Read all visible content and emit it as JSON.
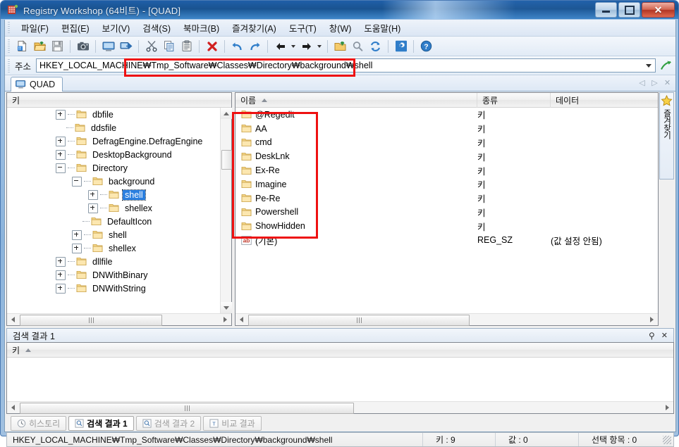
{
  "window": {
    "title": "Registry Workshop (64비트) - [QUAD]",
    "app_icon": "registry-app-icon",
    "minimize_label": "최소화",
    "maximize_label": "최대화",
    "close_label": "닫기"
  },
  "menu": {
    "items": [
      {
        "label": "파일(F)"
      },
      {
        "label": "편집(E)"
      },
      {
        "label": "보기(V)"
      },
      {
        "label": "검색(S)"
      },
      {
        "label": "북마크(B)"
      },
      {
        "label": "즐겨찾기(A)"
      },
      {
        "label": "도구(T)"
      },
      {
        "label": "창(W)"
      },
      {
        "label": "도움말(H)"
      }
    ]
  },
  "toolbar": {
    "buttons": [
      {
        "icon": "new-document-icon",
        "sep_after": false
      },
      {
        "icon": "open-folder-icon",
        "sep_after": false
      },
      {
        "icon": "save-icon",
        "sep_after": true
      },
      {
        "icon": "snapshot-camera-icon",
        "sep_after": true
      },
      {
        "icon": "monitor-icon",
        "sep_after": false
      },
      {
        "icon": "export-monitor-icon",
        "sep_after": true
      },
      {
        "icon": "cut-scissors-icon",
        "sep_after": false
      },
      {
        "icon": "copy-icon",
        "sep_after": false
      },
      {
        "icon": "paste-icon",
        "sep_after": true
      },
      {
        "icon": "delete-x-icon",
        "sep_after": true
      },
      {
        "icon": "undo-icon",
        "sep_after": false
      },
      {
        "icon": "redo-icon",
        "sep_after": true
      },
      {
        "icon": "back-arrow-icon",
        "sep_after": false,
        "dropdown": true
      },
      {
        "icon": "forward-arrow-icon",
        "sep_after": true,
        "dropdown": true
      },
      {
        "icon": "parent-folder-up-icon",
        "sep_after": false
      },
      {
        "icon": "find-magnifier-icon",
        "sep_after": false
      },
      {
        "icon": "refresh-icon",
        "sep_after": true
      },
      {
        "icon": "settings-gear-icon",
        "sep_after": true
      },
      {
        "icon": "help-question-icon",
        "sep_after": false
      }
    ]
  },
  "address": {
    "label": "주소",
    "value": "HKEY_LOCAL_MACHINE₩Tmp_Software₩Classes₩Directory₩background₩shell",
    "dropdown_icon": "chevron-down-icon",
    "go_icon": "go-arrow-icon"
  },
  "doc_tabs": {
    "tabs": [
      {
        "label": "QUAD",
        "icon": "monitor-icon",
        "active": true
      }
    ],
    "nav_prev_icon": "triangle-left-icon",
    "nav_next_icon": "triangle-right-icon",
    "close_icon": "close-x-icon"
  },
  "favorites_panel": {
    "icon": "star-icon",
    "label": "즐겨찾기"
  },
  "tree_pane": {
    "column_header": "키",
    "nodes": [
      {
        "label": "dbfile",
        "indent": 3,
        "expander": "plus",
        "selected": false
      },
      {
        "label": "ddsfile",
        "indent": 3,
        "expander": "none",
        "selected": false
      },
      {
        "label": "DefragEngine.DefragEngine",
        "indent": 3,
        "expander": "plus",
        "selected": false
      },
      {
        "label": "DesktopBackground",
        "indent": 3,
        "expander": "plus",
        "selected": false
      },
      {
        "label": "Directory",
        "indent": 3,
        "expander": "minus",
        "selected": false
      },
      {
        "label": "background",
        "indent": 4,
        "expander": "minus",
        "selected": false
      },
      {
        "label": "shell",
        "indent": 5,
        "expander": "plus",
        "selected": true
      },
      {
        "label": "shellex",
        "indent": 5,
        "expander": "plus",
        "selected": false
      },
      {
        "label": "DefaultIcon",
        "indent": 4,
        "expander": "none",
        "selected": false
      },
      {
        "label": "shell",
        "indent": 4,
        "expander": "plus",
        "selected": false
      },
      {
        "label": "shellex",
        "indent": 4,
        "expander": "plus",
        "selected": false
      },
      {
        "label": "dllfile",
        "indent": 3,
        "expander": "plus",
        "selected": false
      },
      {
        "label": "DNWithBinary",
        "indent": 3,
        "expander": "plus",
        "selected": false
      },
      {
        "label": "DNWithString",
        "indent": 3,
        "expander": "plus",
        "selected": false
      }
    ]
  },
  "list_pane": {
    "columns": [
      {
        "label": "이름",
        "sorted": "asc"
      },
      {
        "label": "종류",
        "sorted": "none"
      },
      {
        "label": "데이터",
        "sorted": "none"
      }
    ],
    "rows": [
      {
        "name": "@Regedit",
        "type": "키",
        "data": "",
        "icon": "folder-icon"
      },
      {
        "name": "AA",
        "type": "키",
        "data": "",
        "icon": "folder-icon"
      },
      {
        "name": "cmd",
        "type": "키",
        "data": "",
        "icon": "folder-icon"
      },
      {
        "name": "DeskLnk",
        "type": "키",
        "data": "",
        "icon": "folder-icon"
      },
      {
        "name": "Ex-Re",
        "type": "키",
        "data": "",
        "icon": "folder-icon"
      },
      {
        "name": "Imagine",
        "type": "키",
        "data": "",
        "icon": "folder-icon"
      },
      {
        "name": "Pe-Re",
        "type": "키",
        "data": "",
        "icon": "folder-icon"
      },
      {
        "name": "Powershell",
        "type": "키",
        "data": "",
        "icon": "folder-icon"
      },
      {
        "name": "ShowHidden",
        "type": "키",
        "data": "",
        "icon": "folder-icon"
      },
      {
        "name": "(기본)",
        "type": "REG_SZ",
        "data": "(값 설정 안됨)",
        "icon": "string-value-icon"
      }
    ]
  },
  "dock": {
    "caption": "검색 결과 1",
    "pin_icon": "pin-icon",
    "close_icon": "close-x-icon",
    "column_header": "키",
    "sort": "asc"
  },
  "bottom_tabs": [
    {
      "label": "히스토리",
      "icon": "history-icon",
      "active": false
    },
    {
      "label": "검색 결과 1",
      "icon": "search-result-icon",
      "active": true
    },
    {
      "label": "검색 결과 2",
      "icon": "search-result-icon",
      "active": false
    },
    {
      "label": "비교 결과",
      "icon": "compare-icon",
      "active": false
    }
  ],
  "statusbar": {
    "path": "HKEY_LOCAL_MACHINE₩Tmp_Software₩Classes₩Directory₩background₩shell",
    "keys": "키 : 9",
    "values": "값 : 0",
    "selected": "선택 항목 : 0",
    "resize_grip_icon": "resize-grip-icon"
  },
  "annotations": {
    "address_highlight_color": "#ee1111",
    "list_highlight_color": "#ee1111"
  }
}
